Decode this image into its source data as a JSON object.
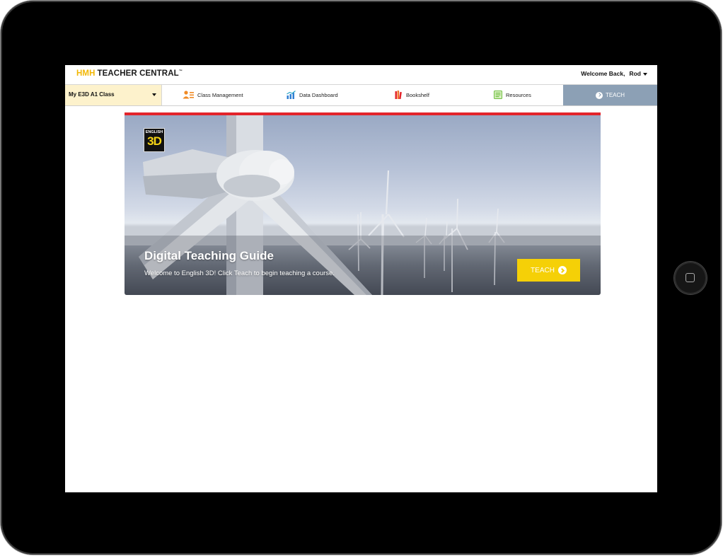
{
  "header": {
    "logo_brand": "HMH",
    "logo_product": "TEACHER CENTRAL",
    "logo_mark": "™",
    "welcome_label": "Welcome Back,",
    "user_name": "Rod"
  },
  "nav": {
    "class_selector": {
      "value": "My E3D A1 Class"
    },
    "items": [
      {
        "label": "Class Management",
        "icon": "class-management-icon"
      },
      {
        "label": "Data Dashboard",
        "icon": "chart-icon"
      },
      {
        "label": "Bookshelf",
        "icon": "books-icon"
      },
      {
        "label": "Resources",
        "icon": "resources-icon"
      }
    ],
    "teach_tab": {
      "label": "TEACH",
      "icon": "arrow-circle-icon"
    }
  },
  "hero": {
    "badge_top": "ENGLISH",
    "badge_main": "3D",
    "title": "Digital Teaching Guide",
    "subtitle": "Welcome to English 3D! Click Teach to begin teaching a course.",
    "button_label": "TEACH"
  },
  "colors": {
    "brand_yellow": "#f2b705",
    "teach_tab": "#8ca0b5",
    "accent_red": "#e3242b",
    "teach_button": "#f5d007"
  }
}
